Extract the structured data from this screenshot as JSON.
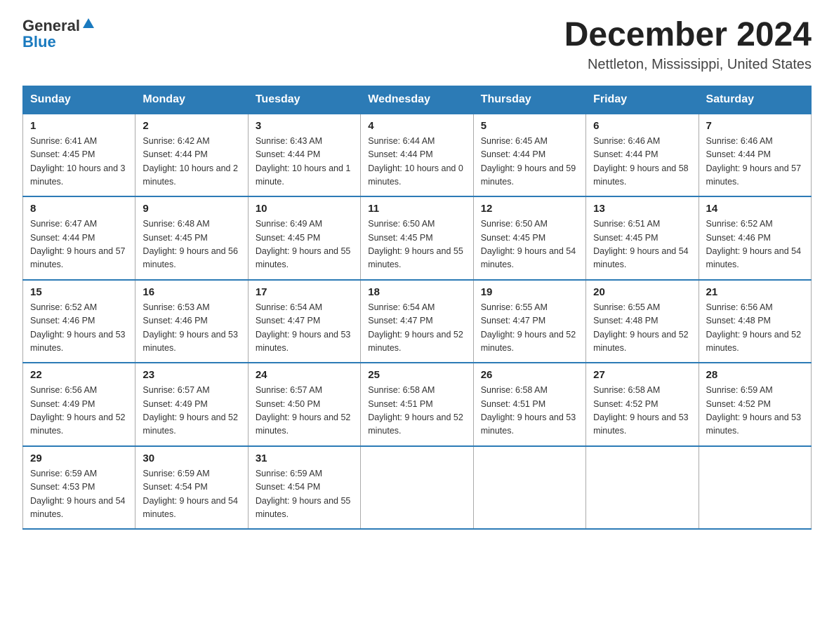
{
  "logo": {
    "general": "General",
    "blue": "Blue"
  },
  "header": {
    "month": "December 2024",
    "location": "Nettleton, Mississippi, United States"
  },
  "days_of_week": [
    "Sunday",
    "Monday",
    "Tuesday",
    "Wednesday",
    "Thursday",
    "Friday",
    "Saturday"
  ],
  "weeks": [
    [
      {
        "day": "1",
        "sunrise": "6:41 AM",
        "sunset": "4:45 PM",
        "daylight": "10 hours and 3 minutes."
      },
      {
        "day": "2",
        "sunrise": "6:42 AM",
        "sunset": "4:44 PM",
        "daylight": "10 hours and 2 minutes."
      },
      {
        "day": "3",
        "sunrise": "6:43 AM",
        "sunset": "4:44 PM",
        "daylight": "10 hours and 1 minute."
      },
      {
        "day": "4",
        "sunrise": "6:44 AM",
        "sunset": "4:44 PM",
        "daylight": "10 hours and 0 minutes."
      },
      {
        "day": "5",
        "sunrise": "6:45 AM",
        "sunset": "4:44 PM",
        "daylight": "9 hours and 59 minutes."
      },
      {
        "day": "6",
        "sunrise": "6:46 AM",
        "sunset": "4:44 PM",
        "daylight": "9 hours and 58 minutes."
      },
      {
        "day": "7",
        "sunrise": "6:46 AM",
        "sunset": "4:44 PM",
        "daylight": "9 hours and 57 minutes."
      }
    ],
    [
      {
        "day": "8",
        "sunrise": "6:47 AM",
        "sunset": "4:44 PM",
        "daylight": "9 hours and 57 minutes."
      },
      {
        "day": "9",
        "sunrise": "6:48 AM",
        "sunset": "4:45 PM",
        "daylight": "9 hours and 56 minutes."
      },
      {
        "day": "10",
        "sunrise": "6:49 AM",
        "sunset": "4:45 PM",
        "daylight": "9 hours and 55 minutes."
      },
      {
        "day": "11",
        "sunrise": "6:50 AM",
        "sunset": "4:45 PM",
        "daylight": "9 hours and 55 minutes."
      },
      {
        "day": "12",
        "sunrise": "6:50 AM",
        "sunset": "4:45 PM",
        "daylight": "9 hours and 54 minutes."
      },
      {
        "day": "13",
        "sunrise": "6:51 AM",
        "sunset": "4:45 PM",
        "daylight": "9 hours and 54 minutes."
      },
      {
        "day": "14",
        "sunrise": "6:52 AM",
        "sunset": "4:46 PM",
        "daylight": "9 hours and 54 minutes."
      }
    ],
    [
      {
        "day": "15",
        "sunrise": "6:52 AM",
        "sunset": "4:46 PM",
        "daylight": "9 hours and 53 minutes."
      },
      {
        "day": "16",
        "sunrise": "6:53 AM",
        "sunset": "4:46 PM",
        "daylight": "9 hours and 53 minutes."
      },
      {
        "day": "17",
        "sunrise": "6:54 AM",
        "sunset": "4:47 PM",
        "daylight": "9 hours and 53 minutes."
      },
      {
        "day": "18",
        "sunrise": "6:54 AM",
        "sunset": "4:47 PM",
        "daylight": "9 hours and 52 minutes."
      },
      {
        "day": "19",
        "sunrise": "6:55 AM",
        "sunset": "4:47 PM",
        "daylight": "9 hours and 52 minutes."
      },
      {
        "day": "20",
        "sunrise": "6:55 AM",
        "sunset": "4:48 PM",
        "daylight": "9 hours and 52 minutes."
      },
      {
        "day": "21",
        "sunrise": "6:56 AM",
        "sunset": "4:48 PM",
        "daylight": "9 hours and 52 minutes."
      }
    ],
    [
      {
        "day": "22",
        "sunrise": "6:56 AM",
        "sunset": "4:49 PM",
        "daylight": "9 hours and 52 minutes."
      },
      {
        "day": "23",
        "sunrise": "6:57 AM",
        "sunset": "4:49 PM",
        "daylight": "9 hours and 52 minutes."
      },
      {
        "day": "24",
        "sunrise": "6:57 AM",
        "sunset": "4:50 PM",
        "daylight": "9 hours and 52 minutes."
      },
      {
        "day": "25",
        "sunrise": "6:58 AM",
        "sunset": "4:51 PM",
        "daylight": "9 hours and 52 minutes."
      },
      {
        "day": "26",
        "sunrise": "6:58 AM",
        "sunset": "4:51 PM",
        "daylight": "9 hours and 53 minutes."
      },
      {
        "day": "27",
        "sunrise": "6:58 AM",
        "sunset": "4:52 PM",
        "daylight": "9 hours and 53 minutes."
      },
      {
        "day": "28",
        "sunrise": "6:59 AM",
        "sunset": "4:52 PM",
        "daylight": "9 hours and 53 minutes."
      }
    ],
    [
      {
        "day": "29",
        "sunrise": "6:59 AM",
        "sunset": "4:53 PM",
        "daylight": "9 hours and 54 minutes."
      },
      {
        "day": "30",
        "sunrise": "6:59 AM",
        "sunset": "4:54 PM",
        "daylight": "9 hours and 54 minutes."
      },
      {
        "day": "31",
        "sunrise": "6:59 AM",
        "sunset": "4:54 PM",
        "daylight": "9 hours and 55 minutes."
      },
      null,
      null,
      null,
      null
    ]
  ]
}
